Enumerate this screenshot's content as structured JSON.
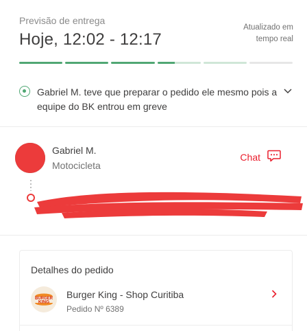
{
  "delivery": {
    "eta_label": "Previsão de entrega",
    "eta_time": "Hoje, 12:02 - 12:17",
    "updated_line1": "Atualizado em",
    "updated_line2": "tempo real",
    "progress": [
      "done",
      "done",
      "done",
      "partial",
      "light",
      "empty"
    ]
  },
  "status": {
    "message": "Gabriel M. teve que preparar o pedido ele mesmo pois a equipe do BK entrou em greve"
  },
  "driver": {
    "name": "Gabriel M.",
    "vehicle": "Motocicleta",
    "chat_label": "Chat"
  },
  "order": {
    "title": "Detalhes do pedido",
    "store_name": "Burger King - Shop Curitiba",
    "order_number": "Pedido Nº 6389",
    "logo_line1": "BURGER",
    "logo_line2": "KING"
  },
  "colors": {
    "accent_red": "#ea1d2c",
    "progress_green": "#50a773",
    "redaction_red": "#ec3b3b"
  }
}
